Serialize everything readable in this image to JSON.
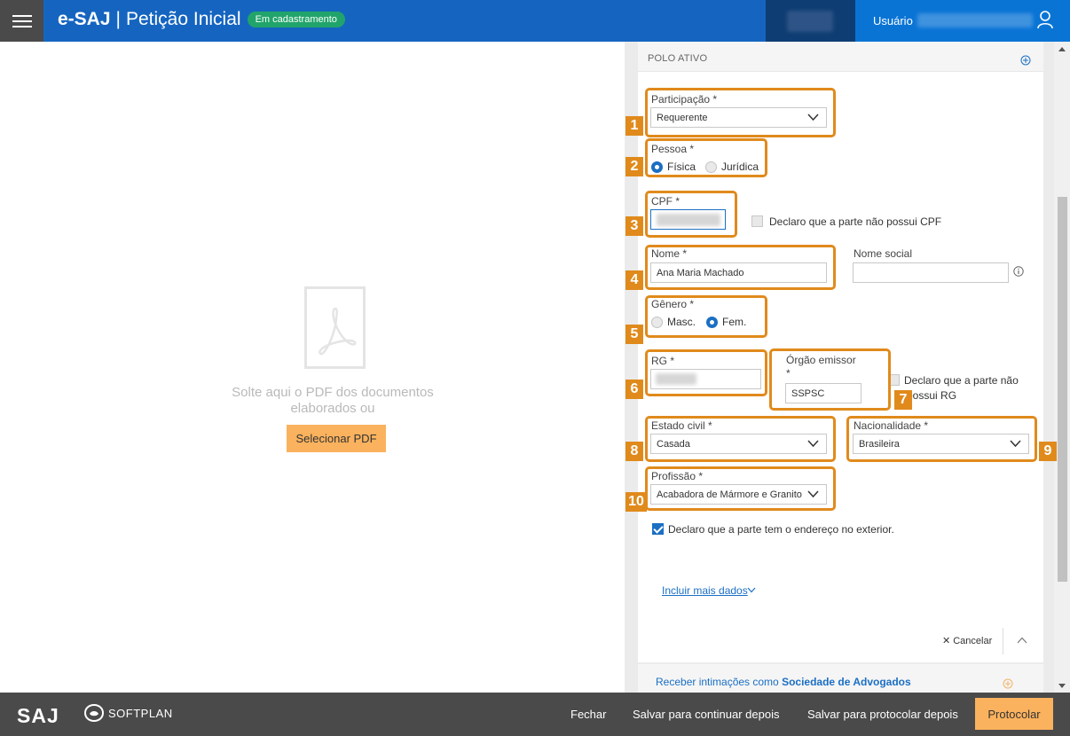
{
  "header": {
    "brand": "e-SAJ",
    "separator": "|",
    "title": "Petição Inicial",
    "status": "Em cadastramento",
    "user_label": "Usuário"
  },
  "drop_area": {
    "text_line1": "Solte aqui o PDF dos documentos",
    "text_line2": "elaborados ou",
    "button": "Selecionar PDF"
  },
  "panel": {
    "section_title": "POLO ATIVO",
    "participacao": {
      "label": "Participação *",
      "value": "Requerente"
    },
    "pessoa": {
      "label": "Pessoa *",
      "options": [
        "Física",
        "Jurídica"
      ],
      "selected": "Física"
    },
    "cpf": {
      "label": "CPF *",
      "declaro": "Declaro que a parte não possui CPF"
    },
    "nome": {
      "label": "Nome *",
      "value": "Ana Maria Machado"
    },
    "nome_social": {
      "label": "Nome social",
      "value": ""
    },
    "genero": {
      "label": "Gênero *",
      "options": [
        "Masc.",
        "Fem."
      ],
      "selected": "Fem."
    },
    "rg": {
      "label": "RG *"
    },
    "orgao": {
      "label": "Órgão emissor",
      "required": "*",
      "value": "SSPSC"
    },
    "rg_declaro": {
      "line1": "Declaro que a parte não",
      "line2": "possui RG"
    },
    "estado_civil": {
      "label": "Estado civil *",
      "value": "Casada"
    },
    "nacionalidade": {
      "label": "Nacionalidade *",
      "value": "Brasileira"
    },
    "profissao": {
      "label": "Profissão *",
      "value": "Acabadora de Mármore e Granito"
    },
    "exterior": "Declaro que a parte tem o endereço no exterior.",
    "incluir": "Incluir mais dados",
    "cancelar": "Cancelar",
    "receber_prefix": "Receber intimações como",
    "receber_bold": "Sociedade de Advogados"
  },
  "annotations": [
    "1",
    "2",
    "3",
    "4",
    "5",
    "6",
    "7",
    "8",
    "9",
    "10"
  ],
  "footer": {
    "saj": "SAJ",
    "softplan": "SOFTPLAN",
    "fechar": "Fechar",
    "salvar_continuar": "Salvar para continuar depois",
    "salvar_protocolar": "Salvar para protocolar depois",
    "protocolar": "Protocolar"
  },
  "colors": {
    "header_blue": "#1565c0",
    "user_blue": "#0a74d5",
    "status_green": "#21a46b",
    "accent_orange": "#fbb25e",
    "annotation_orange": "#e08a1c",
    "footer_gray": "#4a4a4a"
  }
}
